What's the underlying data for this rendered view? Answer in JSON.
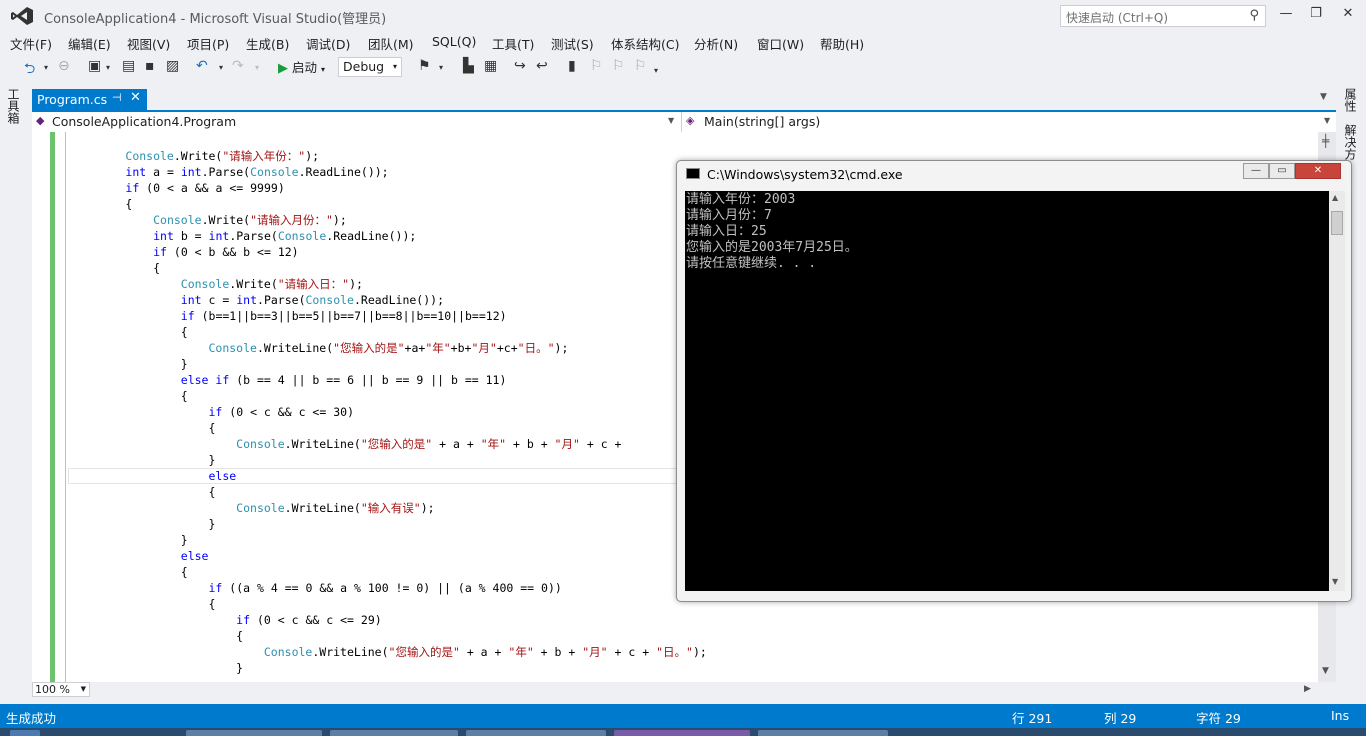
{
  "window": {
    "title": "ConsoleApplication4 - Microsoft Visual Studio(管理员)",
    "quick_launch_placeholder": "快速启动 (Ctrl+Q)",
    "minimize": "—",
    "maximize": "❐",
    "close": "✕"
  },
  "menu": [
    "文件(F)",
    "编辑(E)",
    "视图(V)",
    "项目(P)",
    "生成(B)",
    "调试(D)",
    "团队(M)",
    "SQL(Q)",
    "工具(T)",
    "测试(S)",
    "体系结构(C)",
    "分析(N)",
    "窗口(W)",
    "帮助(H)"
  ],
  "toolbar": {
    "start_label": "启动",
    "config": "Debug"
  },
  "left_strip": {
    "toolbox": "工具箱"
  },
  "right_strip": {
    "tab1": "属性",
    "tab2": "解决方"
  },
  "tab": {
    "label": "Program.cs",
    "pin": "⊣",
    "close": "✕"
  },
  "navbar": {
    "type": "ConsoleApplication4.Program",
    "member": "Main(string[] args)"
  },
  "code_lines": [
    "        Console.Write(\"请输入年份：\");",
    "        int a = int.Parse(Console.ReadLine());",
    "        if (0 < a && a <= 9999)",
    "        {",
    "            Console.Write(\"请输入月份：\");",
    "            int b = int.Parse(Console.ReadLine());",
    "            if (0 < b && b <= 12)",
    "            {",
    "                Console.Write(\"请输入日：\");",
    "                int c = int.Parse(Console.ReadLine());",
    "                if (b==1||b==3||b==5||b==7||b==8||b==10||b==12)",
    "                {",
    "                    Console.WriteLine(\"您输入的是\"+a+\"年\"+b+\"月\"+c+\"日。\");",
    "                }",
    "                else if (b == 4 || b == 6 || b == 9 || b == 11)",
    "                {",
    "                    if (0 < c && c <= 30)",
    "                    {",
    "                        Console.WriteLine(\"您输入的是\" + a + \"年\" + b + \"月\" + c +",
    "                    }",
    "                    else",
    "                    {",
    "                        Console.WriteLine(\"输入有误\");",
    "                    }",
    "                }",
    "                else",
    "                {",
    "                    if ((a % 4 == 0 && a % 100 != 0) || (a % 400 == 0))",
    "                    {",
    "                        if (0 < c && c <= 29)",
    "                        {",
    "                            Console.WriteLine(\"您输入的是\" + a + \"年\" + b + \"月\" + c + \"日。\");",
    "                        }"
  ],
  "editor": {
    "zoom": "100 %"
  },
  "status": {
    "message": "生成成功",
    "line": "行 291",
    "col": "列 29",
    "char": "字符 29",
    "mode": "Ins"
  },
  "cmd": {
    "title": "C:\\Windows\\system32\\cmd.exe",
    "output": [
      "请输入年份：2003",
      "请输入月份：7",
      "请输入日：25",
      "您输入的是2003年7月25日。",
      "请按任意键继续. . ."
    ]
  },
  "colors": {
    "accent": "#007acc",
    "keyword": "#0000ff",
    "type": "#2b91af",
    "string": "#a31515"
  }
}
